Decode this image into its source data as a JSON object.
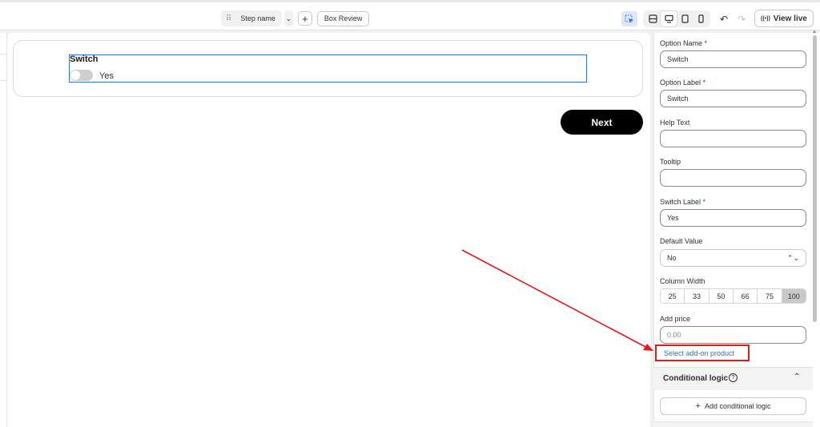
{
  "toolbar": {
    "step_name": "Step name",
    "box_review": "Box Review",
    "view_live": "View live"
  },
  "canvas": {
    "field_title": "Switch",
    "switch_text": "Yes",
    "next_label": "Next"
  },
  "panel": {
    "option_name_label": "Option Name",
    "option_name_value": "Switch",
    "option_label_label": "Option Label",
    "option_label_value": "Switch",
    "help_text_label": "Help Text",
    "help_text_value": "",
    "tooltip_label": "Tooltip",
    "tooltip_value": "",
    "switch_label_label": "Switch Label",
    "switch_label_value": "Yes",
    "default_value_label": "Default Value",
    "default_value_selected": "No",
    "column_width_label": "Column Width",
    "column_widths": [
      "25",
      "33",
      "50",
      "66",
      "75",
      "100"
    ],
    "column_width_selected": "100",
    "add_price_label": "Add price",
    "add_price_placeholder": "0.00",
    "addon_link": "Select add-on product",
    "conditional_title": "Conditional logic",
    "add_conditional_label": "Add conditional logic",
    "required_mark": "*"
  },
  "colors": {
    "accent_blue": "#3b6fd8",
    "link_blue": "#2c6ecb",
    "annotation_red": "#e21a1a",
    "required_red": "#c70a24"
  }
}
